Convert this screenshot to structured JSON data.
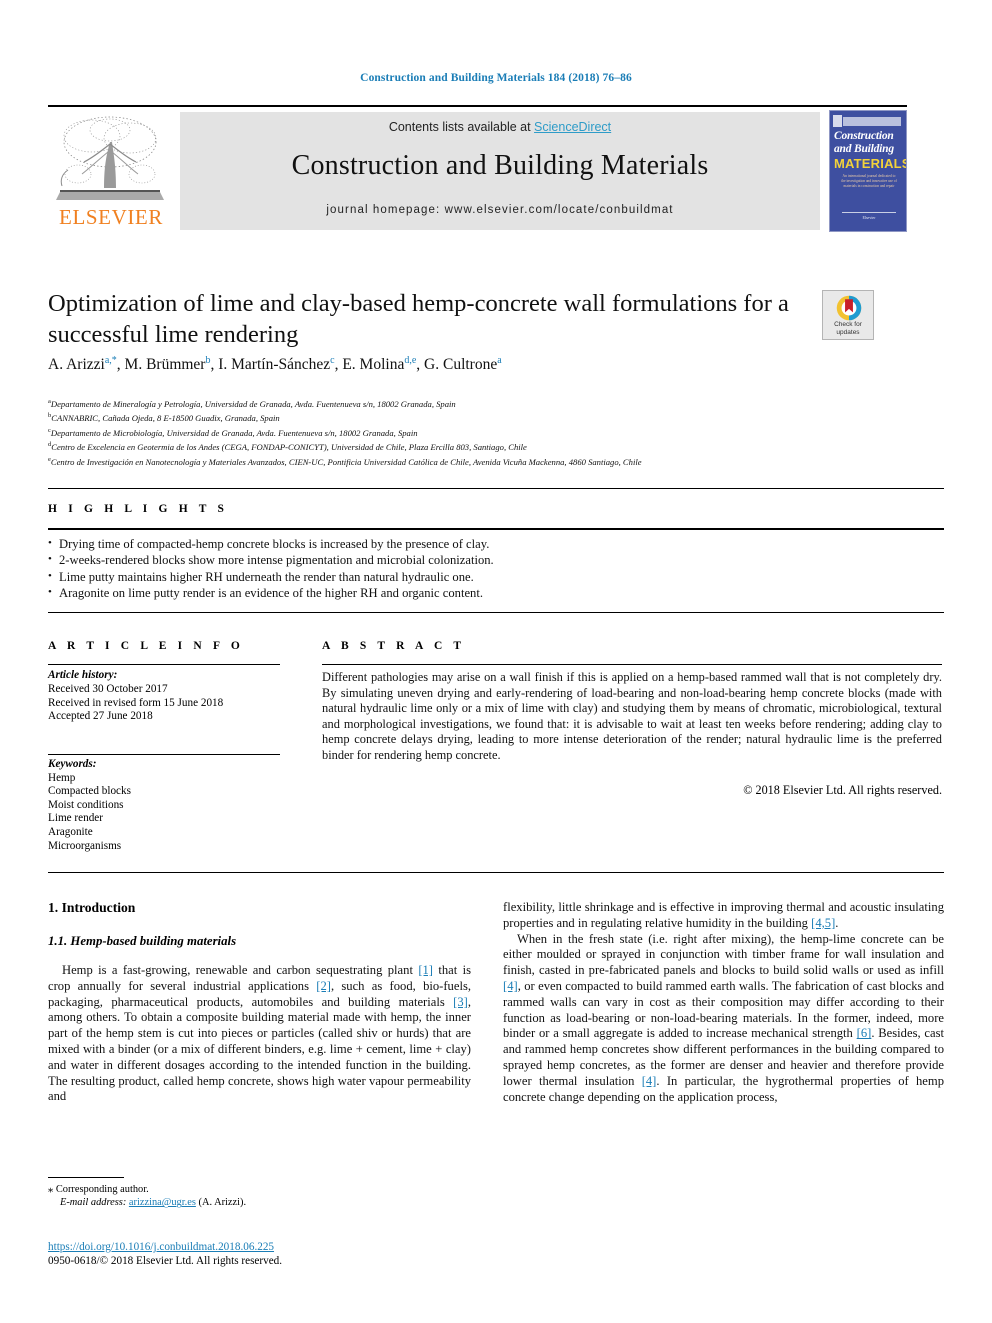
{
  "running_head": "Construction and Building Materials 184 (2018) 76–86",
  "masthead": {
    "contents_prefix": "Contents lists available at ",
    "sciencedirect": "ScienceDirect",
    "journal_name": "Construction and Building Materials",
    "homepage": "journal homepage: www.elsevier.com/locate/conbuildmat",
    "publisher_wordmark": "ELSEVIER",
    "cover": {
      "line1": "Construction",
      "line2": "and Building",
      "line3": "MATERIALS",
      "blurb": "An international journal dedicated to the investigation and innovative use of materials in construction and repair",
      "footer": "Elsevier"
    }
  },
  "article": {
    "title": "Optimization of lime and clay-based hemp-concrete wall formulations for a successful lime rendering",
    "crossmark": {
      "line1": "Check for",
      "line2": "updates"
    },
    "authors": [
      {
        "name": "A. Arizzi",
        "sup": "a,*"
      },
      {
        "name": "M. Brümmer",
        "sup": "b"
      },
      {
        "name": "I. Martín-Sánchez",
        "sup": "c"
      },
      {
        "name": "E. Molina",
        "sup": "d,e"
      },
      {
        "name": "G. Cultrone",
        "sup": "a"
      }
    ],
    "affiliations": [
      {
        "label": "a",
        "text": "Departamento de Mineralogía y Petrología, Universidad de Granada, Avda. Fuentenueva s/n, 18002 Granada, Spain"
      },
      {
        "label": "b",
        "text": "CANNABRIC, Cañada Ojeda, 8 E-18500 Guadix, Granada, Spain"
      },
      {
        "label": "c",
        "text": "Departamento de Microbiología, Universidad de Granada, Avda. Fuentenueva s/n, 18002 Granada, Spain"
      },
      {
        "label": "d",
        "text": "Centro de Excelencia en Geotermia de los Andes (CEGA, FONDAP-CONICYT), Universidad de Chile, Plaza Ercilla 803, Santiago, Chile"
      },
      {
        "label": "e",
        "text": "Centro de Investigación en Nanotecnología y Materiales Avanzados, CIEN-UC, Pontificia Universidad Católica de Chile, Avenida Vicuña Mackenna, 4860 Santiago, Chile"
      }
    ]
  },
  "highlights": {
    "heading": "H I G H L I G H T S",
    "items": [
      "Drying time of compacted-hemp concrete blocks is increased by the presence of clay.",
      "2-weeks-rendered blocks show more intense pigmentation and microbial colonization.",
      "Lime putty maintains higher RH underneath the render than natural hydraulic one.",
      "Aragonite on lime putty render is an evidence of the higher RH and organic content."
    ]
  },
  "article_info": {
    "heading": "A R T I C L E   I N F O",
    "history_label": "Article history:",
    "history": [
      "Received 30 October 2017",
      "Received in revised form 15 June 2018",
      "Accepted 27 June 2018"
    ],
    "keywords_label": "Keywords:",
    "keywords": [
      "Hemp",
      "Compacted blocks",
      "Moist conditions",
      "Lime render",
      "Aragonite",
      "Microorganisms"
    ]
  },
  "abstract": {
    "heading": "A B S T R A C T",
    "text": "Different pathologies may arise on a wall finish if this is applied on a hemp-based rammed wall that is not completely dry. By simulating uneven drying and early-rendering of load-bearing and non-load-bearing hemp concrete blocks (made with natural hydraulic lime only or a mix of lime with clay) and studying them by means of chromatic, microbiological, textural and morphological investigations, we found that: it is advisable to wait at least ten weeks before rendering; adding clay to hemp concrete delays drying, leading to more intense deterioration of the render; natural hydraulic lime is the preferred binder for rendering hemp concrete.",
    "copyright": "© 2018 Elsevier Ltd. All rights reserved."
  },
  "body": {
    "section_number_title": "1. Introduction",
    "subsection_number_title": "1.1. Hemp-based building materials",
    "left_paragraph_1_parts": [
      "Hemp is a fast-growing, renewable and carbon sequestrating plant ",
      "[1]",
      " that is crop annually for several industrial applications ",
      "[2]",
      ", such as food, bio-fuels, packaging, pharmaceutical products, automobiles and building materials ",
      "[3]",
      ", among others. To obtain a composite building material made with hemp, the inner part of the hemp stem is cut into pieces or particles (called shiv or hurds) that are mixed with a binder (or a mix of different binders, e.g. lime + cement, lime + clay) and water in different dosages according to the intended function in the building. The resulting product, called hemp concrete, shows high water vapour permeability and"
    ],
    "right_paragraph_1_parts": [
      "flexibility, little shrinkage and is effective in improving thermal and acoustic insulating properties and in regulating relative humidity in the building ",
      "[4,5]",
      "."
    ],
    "right_paragraph_2_parts": [
      "When in the fresh state (i.e. right after mixing), the hemp-lime concrete can be either moulded or sprayed in conjunction with timber frame for wall insulation and finish, casted in pre-fabricated panels and blocks to build solid walls or used as infill ",
      "[4]",
      ", or even compacted to build rammed earth walls. The fabrication of cast blocks and rammed walls can vary in cost as their composition may differ according to their function as load-bearing or non-load-bearing materials. In the former, indeed, more binder or a small aggregate is added to increase mechanical strength ",
      "[6]",
      ". Besides, cast and rammed hemp concretes show different performances in the building compared to sprayed hemp concretes, as the former are denser and heavier and therefore provide lower thermal insulation ",
      "[4]",
      ". In particular, the hygrothermal properties of hemp concrete change depending on the application process,"
    ]
  },
  "footer": {
    "corresponding_marker": "⁎",
    "corresponding_author": "Corresponding author.",
    "email_label": "E-mail address:",
    "email": "arizzina@ugr.es",
    "email_suffix": "(A. Arizzi).",
    "doi": "https://doi.org/10.1016/j.conbuildmat.2018.06.225",
    "issn_line": "0950-0618/© 2018 Elsevier Ltd. All rights reserved."
  },
  "colors": {
    "link_blue": "#1a7db6",
    "sciencedirect_blue": "#2e9cc8",
    "elsevier_orange": "#f08020",
    "cover_blue": "#3e4fa0",
    "cover_yellow": "#f2d23a"
  }
}
